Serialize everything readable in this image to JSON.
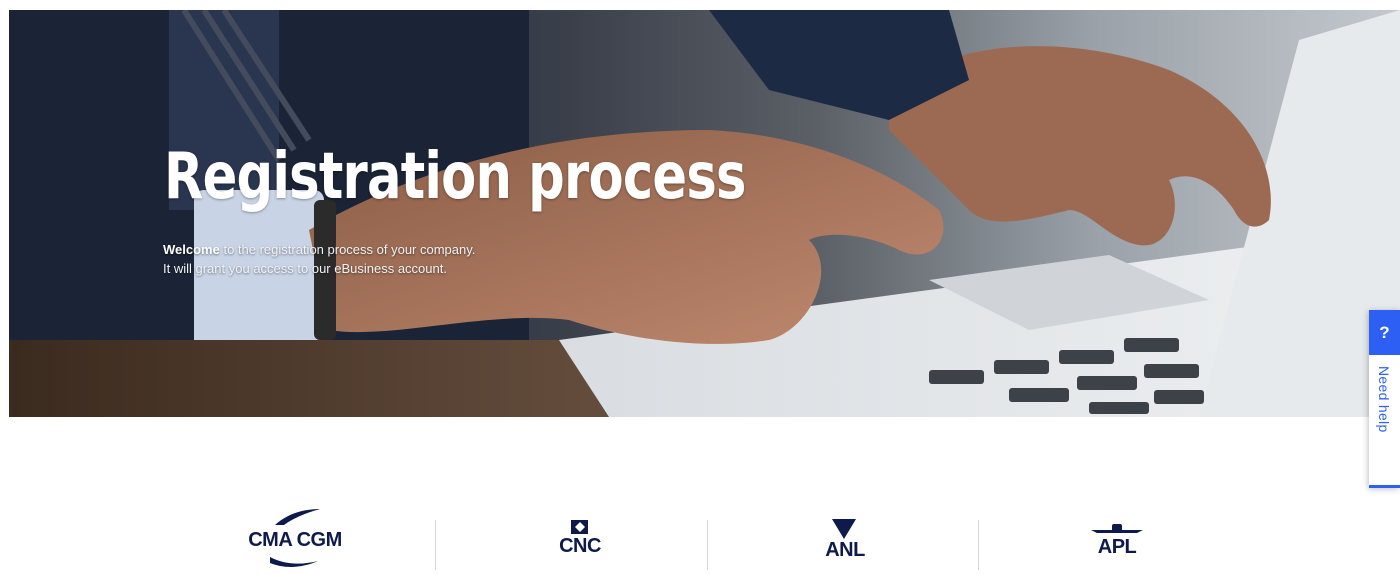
{
  "hero": {
    "title": "Registration process",
    "welcome_bold": "Welcome",
    "welcome_rest": " to the registration process of your company.",
    "line2": "It will grant you access to our eBusiness account."
  },
  "help": {
    "icon": "question-icon",
    "question_mark": "?",
    "label": "Need help"
  },
  "brands": [
    {
      "name": "CMA CGM",
      "icon": "cma-cgm-logo"
    },
    {
      "name": "CNC",
      "icon": "cnc-logo"
    },
    {
      "name": "ANL",
      "icon": "anl-logo"
    },
    {
      "name": "APL",
      "icon": "apl-logo"
    }
  ],
  "colors": {
    "accent": "#2d5ff5",
    "brand_navy": "#0e1a4b"
  }
}
